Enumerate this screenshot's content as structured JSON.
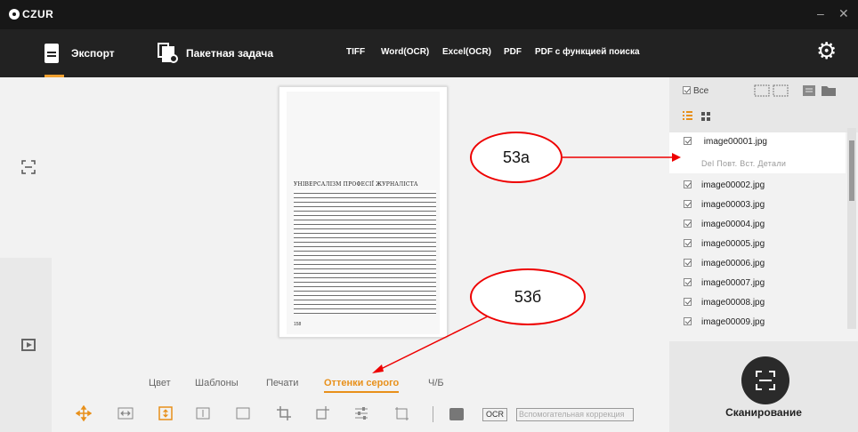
{
  "titlebar": {
    "logo": "CZUR",
    "minimize": "–",
    "close": "✕"
  },
  "toolbar": {
    "export": "Экспорт",
    "batch": "Пакетная задача",
    "formats": [
      "TIFF",
      "Word(OCR)",
      "Excel(OCR)",
      "PDF",
      "PDF с функцией поиска"
    ],
    "settings_icon": "gear-icon"
  },
  "document": {
    "heading": "УНІВЕРСАЛІЗМ ПРОФЕСІЇ ЖУРНАЛІСТА",
    "page_number": "158"
  },
  "tabs": [
    "Цвет",
    "Шаблоны",
    "Печати",
    "Оттенки серого",
    "Ч/Б"
  ],
  "active_tab": "Оттенки серого",
  "bottom_tools": {
    "ocr": "OCR",
    "aux_correction": "Вспомогательная коррекция"
  },
  "right_panel": {
    "select_all": "Все",
    "files": [
      "image00001.jpg",
      "image00002.jpg",
      "image00003.jpg",
      "image00004.jpg",
      "image00005.jpg",
      "image00006.jpg",
      "image00007.jpg",
      "image00008.jpg",
      "image00009.jpg"
    ],
    "selected_actions": "Del  Повт.  Вст.  Детали",
    "scan_label": "Сканирование"
  },
  "callouts": {
    "a": "53а",
    "b": "53б"
  },
  "colors": {
    "accent": "#e8901a",
    "toolbar_bg": "#222222",
    "callout_border": "#e00000"
  }
}
